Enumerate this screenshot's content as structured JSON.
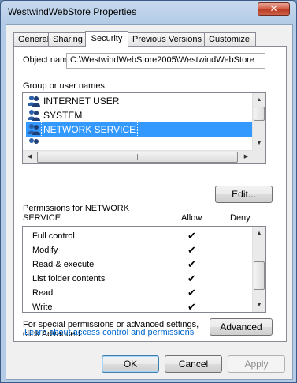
{
  "window": {
    "title": "WestwindWebStore Properties",
    "close_label": "✕"
  },
  "tabs": [
    {
      "label": "General"
    },
    {
      "label": "Sharing"
    },
    {
      "label": "Security",
      "active": true
    },
    {
      "label": "Previous Versions"
    },
    {
      "label": "Customize"
    }
  ],
  "security": {
    "object_name_label": "Object name:",
    "object_name_value": "C:\\WestwindWebStore2005\\WestwindWebStore",
    "group_label": "Group or user names:",
    "users": [
      {
        "name": "INTERNET USER",
        "icon": "users-group-icon"
      },
      {
        "name": "SYSTEM",
        "icon": "users-group-icon"
      },
      {
        "name": "NETWORK SERVICE",
        "icon": "users-group-icon",
        "selected": true
      }
    ],
    "edit_button": "Edit...",
    "permissions_label": "Permissions for NETWORK SERVICE",
    "permissions_label_line1": "Permissions for NETWORK",
    "permissions_label_line2": "SERVICE",
    "allow_header": "Allow",
    "deny_header": "Deny",
    "permissions": [
      {
        "name": "Full control",
        "allow": true,
        "deny": false
      },
      {
        "name": "Modify",
        "allow": true,
        "deny": false
      },
      {
        "name": "Read & execute",
        "allow": true,
        "deny": false
      },
      {
        "name": "List folder contents",
        "allow": true,
        "deny": false
      },
      {
        "name": "Read",
        "allow": true,
        "deny": false
      },
      {
        "name": "Write",
        "allow": true,
        "deny": false
      }
    ],
    "check_glyph": "✔",
    "special_text_line1": "For special permissions or advanced settings,",
    "special_text_line2": "click Advanced.",
    "advanced_button": "Advanced",
    "learn_link": "Learn about access control and permissions"
  },
  "footer": {
    "ok": "OK",
    "cancel": "Cancel",
    "apply": "Apply"
  },
  "colors": {
    "selection": "#3399ff",
    "link": "#0066cc",
    "title_gradient_top": "#c7d9ee",
    "close_red": "#cf5b44"
  }
}
